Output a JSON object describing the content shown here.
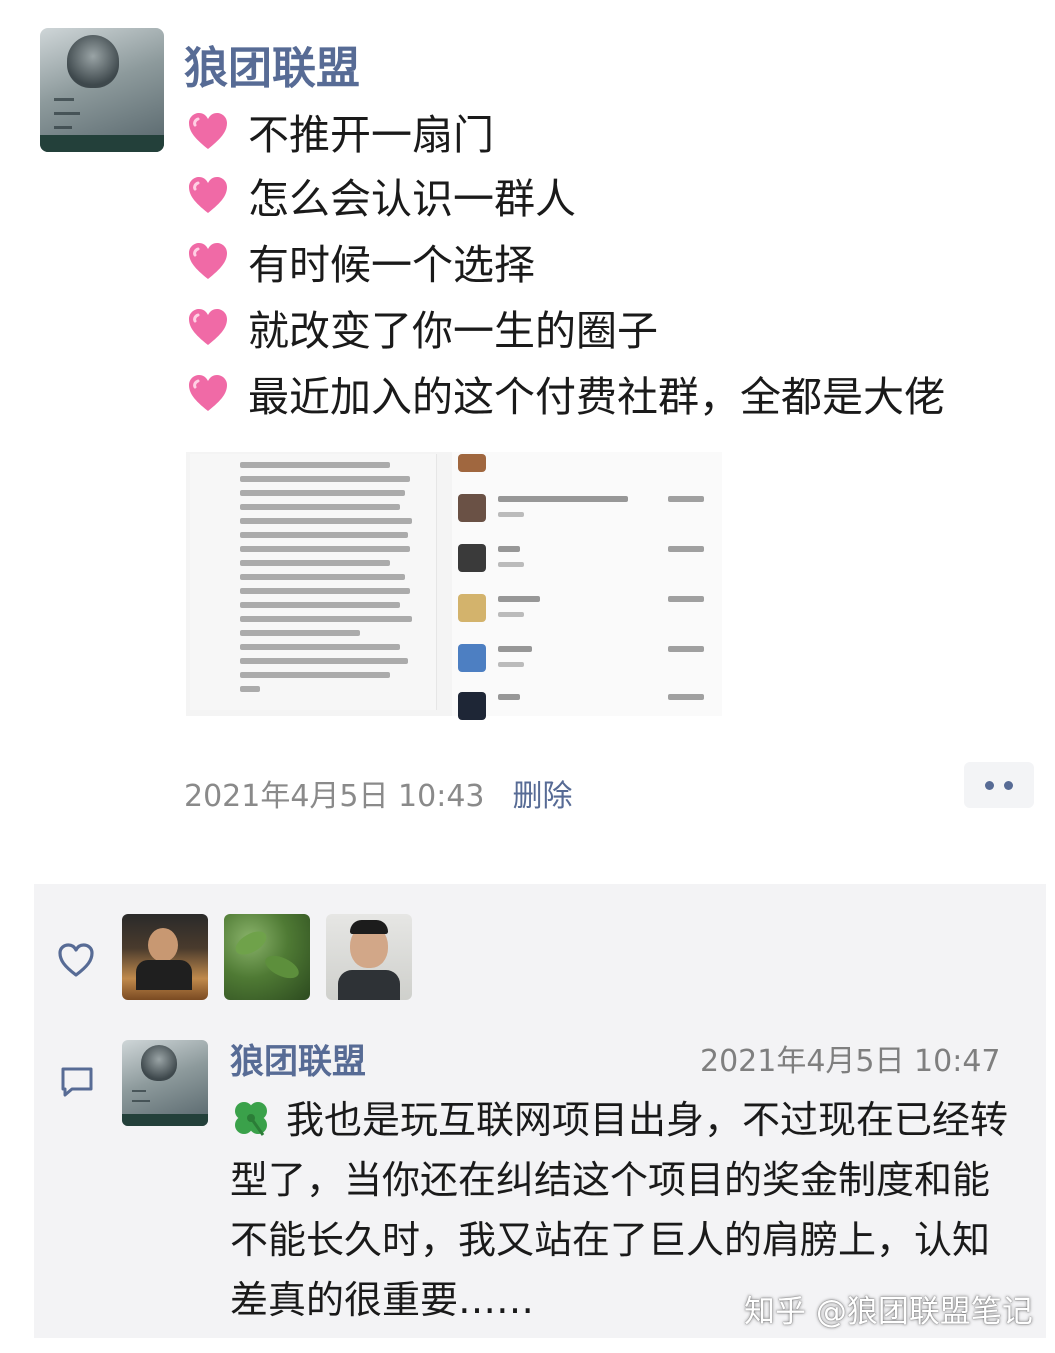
{
  "post": {
    "author": "狼团联盟",
    "lines": [
      "不推开一扇门",
      "怎么会认识一群人",
      "有时候一个选择",
      "就改变了你一生的圈子",
      "最近加入的这个付费社群，全都是大佬"
    ],
    "line_icon": "pink-heart-emoji",
    "timestamp": "2021年4月5日 10:43",
    "delete_label": "删除",
    "more_icon": "more-dots-icon"
  },
  "likes": {
    "icon": "heart-outline-icon",
    "avatars": [
      "liker-avatar-1",
      "liker-avatar-2",
      "liker-avatar-3"
    ]
  },
  "comment": {
    "icon": "comment-bubble-icon",
    "author": "狼团联盟",
    "time": "2021年4月5日 10:47",
    "emoji": "clover-emoji",
    "text": "我也是玩互联网项目出身，不过现在已经转型了，当你还在纠结这个项目的奖金制度和能不能长久时，我又站在了巨人的肩膀上，认知差真的很重要……"
  },
  "watermark": "知乎 @狼团联盟笔记",
  "colors": {
    "link_blue": "#576b95",
    "panel_bg": "#f3f3f5",
    "heart_pink": "#f06aa6"
  }
}
